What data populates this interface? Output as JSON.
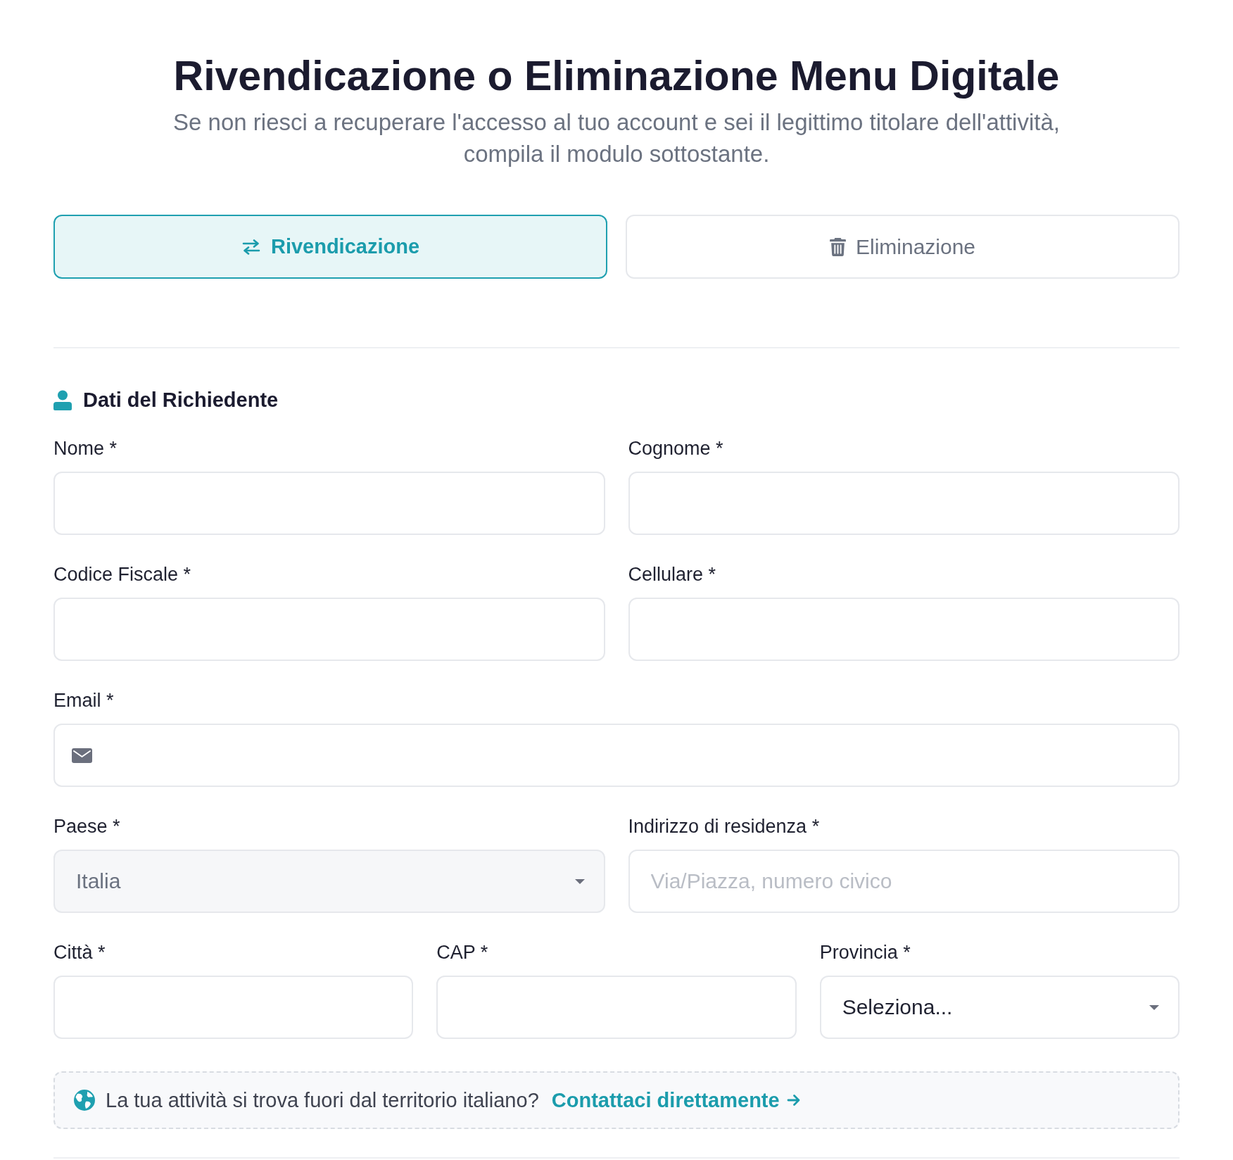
{
  "header": {
    "title": "Rivendicazione o Eliminazione Menu Digitale",
    "subtitle": "Se non riesci a recuperare l'accesso al tuo account e sei il legittimo titolare dell'attività, compila il modulo sottostante."
  },
  "tabs": [
    {
      "label": "Rivendicazione",
      "selected": true
    },
    {
      "label": "Eliminazione",
      "selected": false
    }
  ],
  "section": {
    "title": "Dati del Richiedente"
  },
  "form": {
    "rows": [
      {
        "fields": [
          {
            "label": "Nome *",
            "kind": "text"
          },
          {
            "label": "Cognome *",
            "kind": "text"
          }
        ]
      },
      {
        "fields": [
          {
            "label": "Codice Fiscale *",
            "kind": "text"
          },
          {
            "label": "Cellulare *",
            "kind": "text"
          }
        ]
      },
      {
        "fields": [
          {
            "label": "Email *",
            "kind": "email"
          }
        ]
      },
      {
        "fields": [
          {
            "label": "Paese *",
            "kind": "select",
            "value": "Italia",
            "disabled": true
          },
          {
            "label": "Indirizzo di residenza *",
            "kind": "text",
            "placeholder": "Via/Piazza, numero civico"
          }
        ]
      },
      {
        "fields": [
          {
            "label": "Città *",
            "kind": "text"
          },
          {
            "label": "CAP *",
            "kind": "text"
          },
          {
            "label": "Provincia *",
            "kind": "select",
            "value": "Seleziona...",
            "disabled": false
          }
        ]
      }
    ]
  },
  "notice": {
    "text": "La tua attività si trova fuori dal territorio italiano?",
    "link": "Contattaci direttamente"
  }
}
